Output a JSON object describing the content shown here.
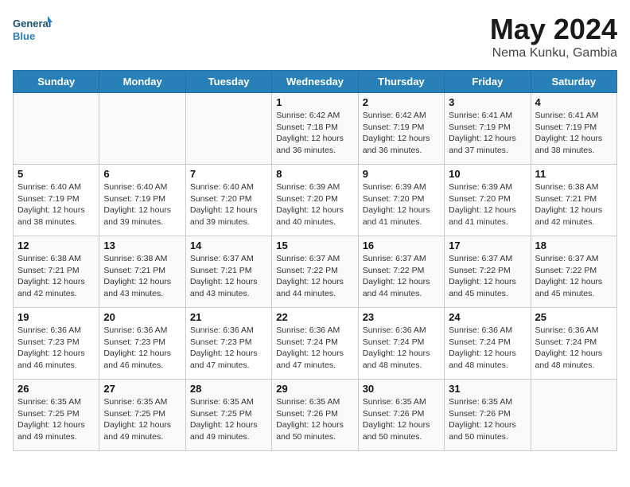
{
  "header": {
    "logo_line1": "General",
    "logo_line2": "Blue",
    "month": "May 2024",
    "location": "Nema Kunku, Gambia"
  },
  "days_of_week": [
    "Sunday",
    "Monday",
    "Tuesday",
    "Wednesday",
    "Thursday",
    "Friday",
    "Saturday"
  ],
  "weeks": [
    [
      {
        "day": "",
        "info": ""
      },
      {
        "day": "",
        "info": ""
      },
      {
        "day": "",
        "info": ""
      },
      {
        "day": "1",
        "info": "Sunrise: 6:42 AM\nSunset: 7:18 PM\nDaylight: 12 hours\nand 36 minutes."
      },
      {
        "day": "2",
        "info": "Sunrise: 6:42 AM\nSunset: 7:19 PM\nDaylight: 12 hours\nand 36 minutes."
      },
      {
        "day": "3",
        "info": "Sunrise: 6:41 AM\nSunset: 7:19 PM\nDaylight: 12 hours\nand 37 minutes."
      },
      {
        "day": "4",
        "info": "Sunrise: 6:41 AM\nSunset: 7:19 PM\nDaylight: 12 hours\nand 38 minutes."
      }
    ],
    [
      {
        "day": "5",
        "info": "Sunrise: 6:40 AM\nSunset: 7:19 PM\nDaylight: 12 hours\nand 38 minutes."
      },
      {
        "day": "6",
        "info": "Sunrise: 6:40 AM\nSunset: 7:19 PM\nDaylight: 12 hours\nand 39 minutes."
      },
      {
        "day": "7",
        "info": "Sunrise: 6:40 AM\nSunset: 7:20 PM\nDaylight: 12 hours\nand 39 minutes."
      },
      {
        "day": "8",
        "info": "Sunrise: 6:39 AM\nSunset: 7:20 PM\nDaylight: 12 hours\nand 40 minutes."
      },
      {
        "day": "9",
        "info": "Sunrise: 6:39 AM\nSunset: 7:20 PM\nDaylight: 12 hours\nand 41 minutes."
      },
      {
        "day": "10",
        "info": "Sunrise: 6:39 AM\nSunset: 7:20 PM\nDaylight: 12 hours\nand 41 minutes."
      },
      {
        "day": "11",
        "info": "Sunrise: 6:38 AM\nSunset: 7:21 PM\nDaylight: 12 hours\nand 42 minutes."
      }
    ],
    [
      {
        "day": "12",
        "info": "Sunrise: 6:38 AM\nSunset: 7:21 PM\nDaylight: 12 hours\nand 42 minutes."
      },
      {
        "day": "13",
        "info": "Sunrise: 6:38 AM\nSunset: 7:21 PM\nDaylight: 12 hours\nand 43 minutes."
      },
      {
        "day": "14",
        "info": "Sunrise: 6:37 AM\nSunset: 7:21 PM\nDaylight: 12 hours\nand 43 minutes."
      },
      {
        "day": "15",
        "info": "Sunrise: 6:37 AM\nSunset: 7:22 PM\nDaylight: 12 hours\nand 44 minutes."
      },
      {
        "day": "16",
        "info": "Sunrise: 6:37 AM\nSunset: 7:22 PM\nDaylight: 12 hours\nand 44 minutes."
      },
      {
        "day": "17",
        "info": "Sunrise: 6:37 AM\nSunset: 7:22 PM\nDaylight: 12 hours\nand 45 minutes."
      },
      {
        "day": "18",
        "info": "Sunrise: 6:37 AM\nSunset: 7:22 PM\nDaylight: 12 hours\nand 45 minutes."
      }
    ],
    [
      {
        "day": "19",
        "info": "Sunrise: 6:36 AM\nSunset: 7:23 PM\nDaylight: 12 hours\nand 46 minutes."
      },
      {
        "day": "20",
        "info": "Sunrise: 6:36 AM\nSunset: 7:23 PM\nDaylight: 12 hours\nand 46 minutes."
      },
      {
        "day": "21",
        "info": "Sunrise: 6:36 AM\nSunset: 7:23 PM\nDaylight: 12 hours\nand 47 minutes."
      },
      {
        "day": "22",
        "info": "Sunrise: 6:36 AM\nSunset: 7:24 PM\nDaylight: 12 hours\nand 47 minutes."
      },
      {
        "day": "23",
        "info": "Sunrise: 6:36 AM\nSunset: 7:24 PM\nDaylight: 12 hours\nand 48 minutes."
      },
      {
        "day": "24",
        "info": "Sunrise: 6:36 AM\nSunset: 7:24 PM\nDaylight: 12 hours\nand 48 minutes."
      },
      {
        "day": "25",
        "info": "Sunrise: 6:36 AM\nSunset: 7:24 PM\nDaylight: 12 hours\nand 48 minutes."
      }
    ],
    [
      {
        "day": "26",
        "info": "Sunrise: 6:35 AM\nSunset: 7:25 PM\nDaylight: 12 hours\nand 49 minutes."
      },
      {
        "day": "27",
        "info": "Sunrise: 6:35 AM\nSunset: 7:25 PM\nDaylight: 12 hours\nand 49 minutes."
      },
      {
        "day": "28",
        "info": "Sunrise: 6:35 AM\nSunset: 7:25 PM\nDaylight: 12 hours\nand 49 minutes."
      },
      {
        "day": "29",
        "info": "Sunrise: 6:35 AM\nSunset: 7:26 PM\nDaylight: 12 hours\nand 50 minutes."
      },
      {
        "day": "30",
        "info": "Sunrise: 6:35 AM\nSunset: 7:26 PM\nDaylight: 12 hours\nand 50 minutes."
      },
      {
        "day": "31",
        "info": "Sunrise: 6:35 AM\nSunset: 7:26 PM\nDaylight: 12 hours\nand 50 minutes."
      },
      {
        "day": "",
        "info": ""
      }
    ]
  ]
}
